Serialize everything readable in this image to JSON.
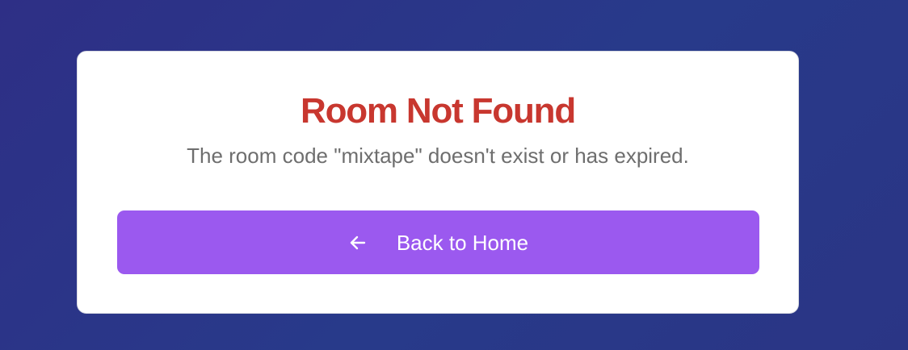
{
  "card": {
    "title": "Room Not Found",
    "message": "The room code \"mixtape\" doesn't exist or has expired.",
    "back_button": {
      "icon": "arrow-left-icon",
      "label": "Back to Home"
    }
  },
  "colors": {
    "background_start": "#2e2f86",
    "background_end": "#283a8a",
    "title": "#c8372f",
    "message": "#6e6e6e",
    "button": "#9b59ef",
    "button_text": "#ffffff"
  }
}
